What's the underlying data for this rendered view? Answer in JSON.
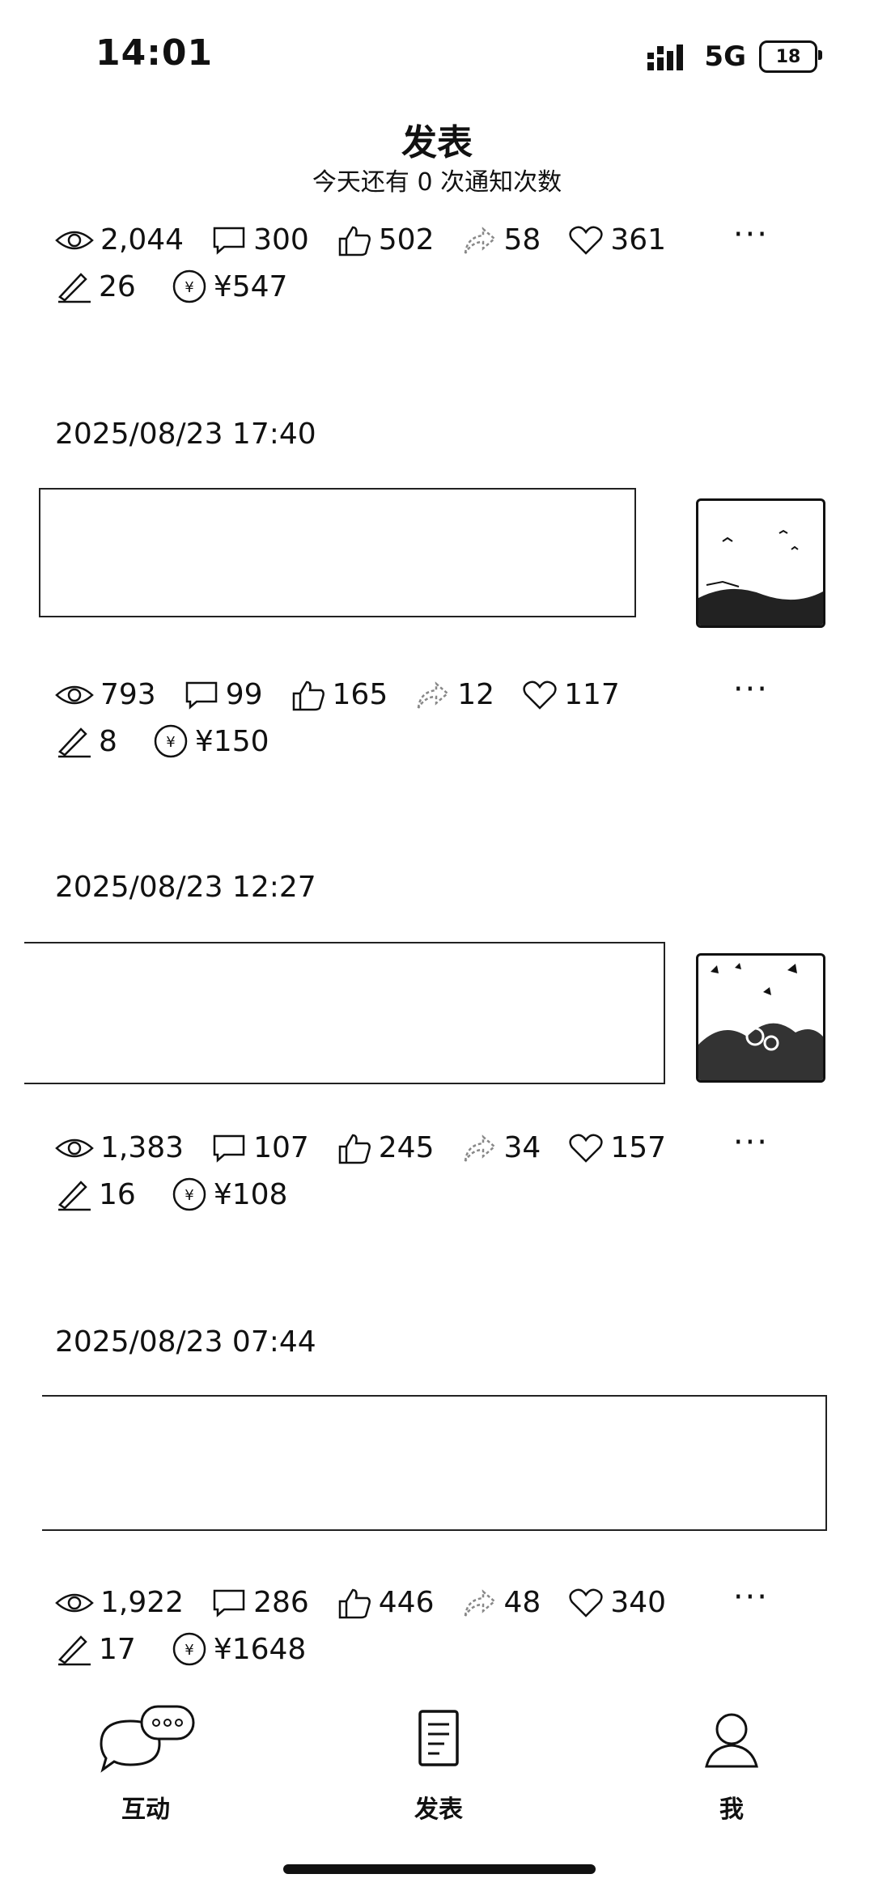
{
  "status": {
    "time": "14:01",
    "network": "5G",
    "battery": "18"
  },
  "header": {
    "title": "发表",
    "subtitle": "今天还有 0 次通知次数"
  },
  "posts": [
    {
      "date": "",
      "views": "2,044",
      "comments": "300",
      "likes": "502",
      "shares": "58",
      "favorites": "361",
      "edits": "26",
      "earnings": "¥547"
    },
    {
      "date": "2025/08/23 17:40",
      "views": "793",
      "comments": "99",
      "likes": "165",
      "shares": "12",
      "favorites": "117",
      "edits": "8",
      "earnings": "¥150"
    },
    {
      "date": "2025/08/23 12:27",
      "views": "1,383",
      "comments": "107",
      "likes": "245",
      "shares": "34",
      "favorites": "157",
      "edits": "16",
      "earnings": "¥108"
    },
    {
      "date": "2025/08/23 07:44",
      "views": "1,922",
      "comments": "286",
      "likes": "446",
      "shares": "48",
      "favorites": "340",
      "edits": "17",
      "earnings": "¥1648"
    }
  ],
  "tabs": [
    {
      "label": "互动",
      "icon": "chat-bubbles-icon"
    },
    {
      "label": "发表",
      "icon": "document-icon"
    },
    {
      "label": "我",
      "icon": "person-icon"
    }
  ]
}
